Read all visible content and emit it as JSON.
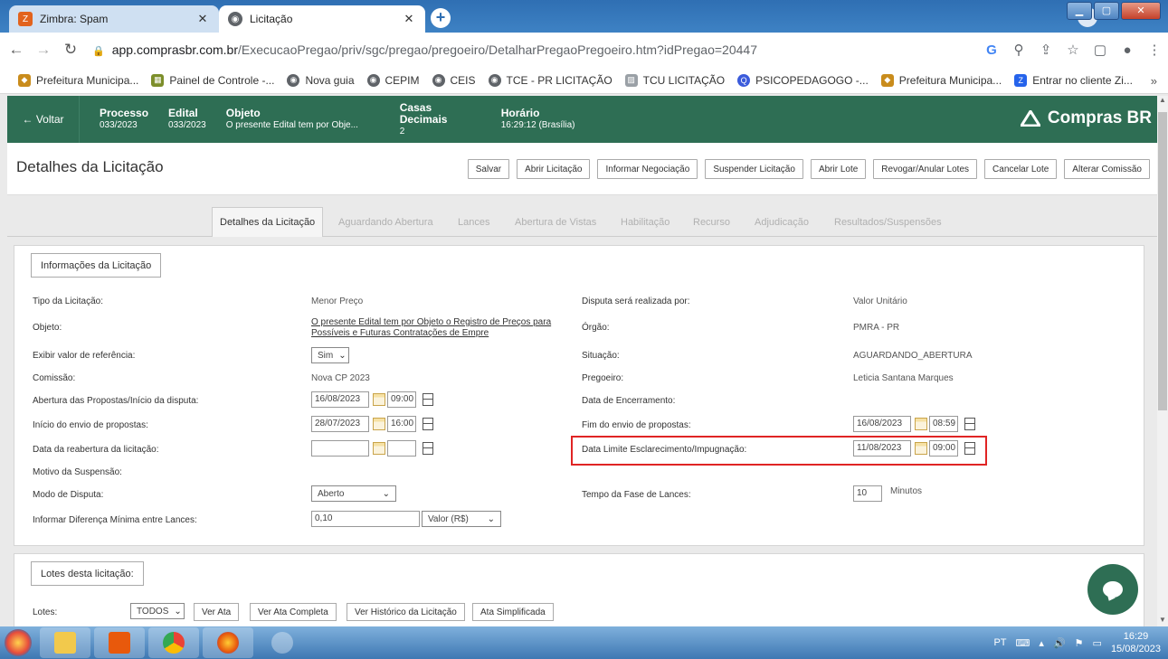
{
  "browser": {
    "tabs": [
      {
        "title": "Zimbra: Spam",
        "icon": "zimbra-icon"
      },
      {
        "title": "Licitação",
        "icon": "globe-icon"
      }
    ],
    "url_host": "app.comprasbr.com.br",
    "url_path": "/ExecucaoPregao/priv/sgc/pregao/pregoeiro/DetalharPregaoPregoeiro.htm?idPregao=20447",
    "bookmarks": [
      "Prefeitura Municipa...",
      "Painel de Controle -...",
      "Nova guia",
      "CEPIM",
      "CEIS",
      "TCE - PR LICITAÇÃO",
      "TCU LICITAÇÃO",
      "PSICOPEDAGOGO -...",
      "Prefeitura Municipa...",
      "Entrar no cliente Zi..."
    ],
    "bookmarks_more": "»"
  },
  "header": {
    "back": "← Voltar",
    "processo_label": "Processo",
    "processo_value": "033/2023",
    "edital_label": "Edital",
    "edital_value": "033/2023",
    "objeto_label": "Objeto",
    "objeto_value": "O presente Edital tem por Obje...",
    "casas_label": "Casas Decimais",
    "casas_value": "2",
    "horario_label": "Horário",
    "horario_value": "16:29:12 (Brasília)",
    "brand": "Compras BR"
  },
  "page": {
    "title": "Detalhes da Licitação",
    "actions": [
      "Salvar",
      "Abrir Licitação",
      "Informar Negociação",
      "Suspender Licitação",
      "Abrir Lote",
      "Revogar/Anular Lotes",
      "Cancelar Lote",
      "Alterar Comissão"
    ],
    "tabs": [
      "Detalhes da Licitação",
      "Aguardando Abertura",
      "Lances",
      "Abertura de Vistas",
      "Habilitação",
      "Recurso",
      "Adjudicação",
      "Resultados/Suspensões"
    ]
  },
  "info": {
    "legend": "Informações da Licitação",
    "tipo_label": "Tipo da Licitação:",
    "tipo_value": "Menor Preço",
    "objeto_label": "Objeto:",
    "objeto_line1": "O presente Edital tem por Objeto o Registro de Preços para",
    "objeto_line2": "Possíveis e Futuras Contratações de Empre",
    "exibir_label": "Exibir valor de referência:",
    "exibir_value": "Sim",
    "comissao_label": "Comissão:",
    "comissao_value": "Nova CP 2023",
    "abertura_label": "Abertura das Propostas/Início da disputa:",
    "abertura_date": "16/08/2023",
    "abertura_time": "09:00",
    "inicio_label": "Início do envio de propostas:",
    "inicio_date": "28/07/2023",
    "inicio_time": "16:00",
    "reabertura_label": "Data da reabertura da licitação:",
    "reabertura_date": "",
    "reabertura_time": "",
    "motivo_label": "Motivo da Suspensão:",
    "modo_label": "Modo de Disputa:",
    "modo_value": "Aberto",
    "diferenca_label": "Informar Diferença Mínima entre Lances:",
    "diferenca_value": "0,10",
    "diferenca_tipo": "Valor (R$)",
    "disputa_label": "Disputa será realizada por:",
    "disputa_value": "Valor Unitário",
    "orgao_label": "Órgão:",
    "orgao_value": "PMRA - PR",
    "situacao_label": "Situação:",
    "situacao_value": "AGUARDANDO_ABERTURA",
    "pregoeiro_label": "Pregoeiro:",
    "pregoeiro_value": "Leticia Santana Marques",
    "encerramento_label": "Data de Encerramento:",
    "fim_label": "Fim do envio de propostas:",
    "fim_date": "16/08/2023",
    "fim_time": "08:59",
    "limite_label": "Data Limite Esclarecimento/Impugnação:",
    "limite_date": "11/08/2023",
    "limite_time": "09:00",
    "tempo_label": "Tempo da Fase de Lances:",
    "tempo_value": "10",
    "tempo_unit": "Minutos"
  },
  "lotes": {
    "legend": "Lotes desta licitação:",
    "label": "Lotes:",
    "select_value": "TODOS",
    "buttons": [
      "Ver Ata",
      "Ver Ata Completa",
      "Ver Histórico da Licitação",
      "Ata Simplificada"
    ]
  },
  "taskbar": {
    "lang": "PT",
    "time": "16:29",
    "date": "15/08/2023"
  },
  "colors": {
    "header_green": "#2e6e54",
    "highlight_red": "#e02424",
    "chrome_blue": "#3e82c4"
  }
}
